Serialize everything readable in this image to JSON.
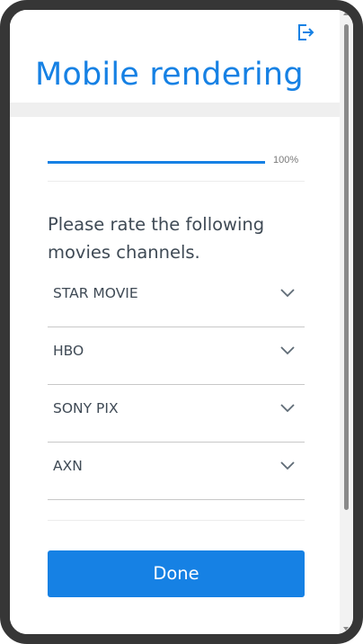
{
  "header": {
    "title": "Mobile rendering",
    "exit_icon": "exit-icon"
  },
  "progress": {
    "percent": 100,
    "label": "100%"
  },
  "survey": {
    "question": "Please rate the following movies channels.",
    "dropdowns": [
      {
        "label": "STAR MOVIE",
        "icon": "chevron-down-icon"
      },
      {
        "label": "HBO",
        "icon": "chevron-down-icon"
      },
      {
        "label": "SONY PIX",
        "icon": "chevron-down-icon"
      },
      {
        "label": "AXN",
        "icon": "chevron-down-icon"
      }
    ],
    "done_label": "Done"
  },
  "colors": {
    "accent": "#1681e4",
    "device_frame": "#363636",
    "text": "#3f4a55"
  }
}
